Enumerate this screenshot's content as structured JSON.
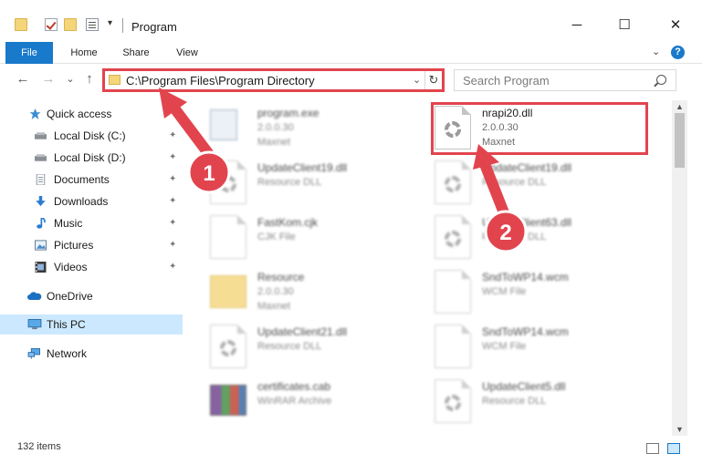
{
  "window": {
    "title": "Program",
    "minimize": "─",
    "maximize": "☐",
    "close": "✕",
    "qa_dropdown": "▾"
  },
  "ribbon": {
    "tabs": [
      {
        "label": "File"
      },
      {
        "label": "Home"
      },
      {
        "label": "Share"
      },
      {
        "label": "View"
      }
    ],
    "help": "?",
    "toggle": "⌄"
  },
  "nav": {
    "back": "←",
    "forward": "→",
    "recent": "⌄",
    "up": "↑",
    "address": "C:\\Program Files\\Program Directory",
    "address_chevron": "⌄",
    "refresh": "↻",
    "search_placeholder": "Search Program"
  },
  "sidebar": {
    "pin": "✦",
    "items": [
      {
        "label": "Quick access",
        "icon": "star-icon"
      },
      {
        "label": "Local Disk (C:)",
        "icon": "drive-icon"
      },
      {
        "label": "Local Disk (D:)",
        "icon": "drive-icon"
      },
      {
        "label": "Documents",
        "icon": "documents-icon"
      },
      {
        "label": "Downloads",
        "icon": "download-icon"
      },
      {
        "label": "Music",
        "icon": "music-icon"
      },
      {
        "label": "Pictures",
        "icon": "pictures-icon"
      },
      {
        "label": "Videos",
        "icon": "video-icon"
      },
      {
        "label": "OneDrive",
        "icon": "cloud-icon"
      },
      {
        "label": "This PC",
        "icon": "computer-icon"
      },
      {
        "label": "Network",
        "icon": "network-icon"
      }
    ]
  },
  "files": [
    {
      "name": "program.exe",
      "line2": "2.0.0.30",
      "line3": "Maxnet"
    },
    {
      "name": "nrapi20.dll",
      "line2": "2.0.0.30",
      "line3": "Maxnet"
    },
    {
      "name": "UpdateClient19.dll",
      "line2": "Resource DLL",
      "line3": ""
    },
    {
      "name": "UpdateClient19.dll",
      "line2": "Resource DLL",
      "line3": ""
    },
    {
      "name": "FastKom.cjk",
      "line2": "CJK File",
      "line3": ""
    },
    {
      "name": "UpdateClient63.dll",
      "line2": "Resource DLL",
      "line3": ""
    },
    {
      "name": "Resource",
      "line2": "2.0.0.30",
      "line3": "Maxnet"
    },
    {
      "name": "SndToWP14.wcm",
      "line2": "WCM File",
      "line3": ""
    },
    {
      "name": "UpdateClient21.dll",
      "line2": "Resource DLL",
      "line3": ""
    },
    {
      "name": "SndToWP14.wcm",
      "line2": "WCM File",
      "line3": ""
    },
    {
      "name": "certificates.cab",
      "line2": "WinRAR Archive",
      "line3": ""
    },
    {
      "name": "UpdateClient5.dll",
      "line2": "Resource DLL",
      "line3": ""
    }
  ],
  "status": {
    "items": "132 items"
  },
  "annotations": {
    "badge1": "1",
    "badge2": "2",
    "color": "#e2444e"
  },
  "scroll": {
    "up": "▲",
    "down": "▼"
  }
}
